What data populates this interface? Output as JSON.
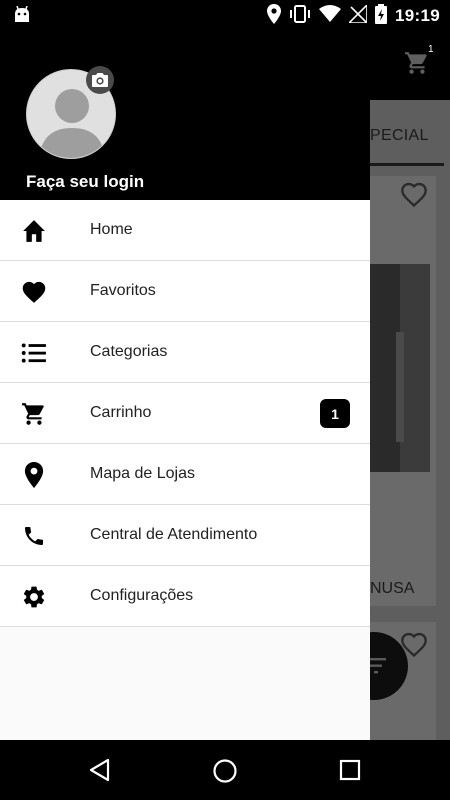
{
  "status_bar": {
    "time": "19:19"
  },
  "background_app": {
    "tab_label": "PECIAL",
    "cart_count": "1",
    "card_text": "NUSA"
  },
  "drawer": {
    "login_text": "Faça seu login",
    "menu": [
      {
        "label": "Home",
        "icon": "home-icon"
      },
      {
        "label": "Favoritos",
        "icon": "heart-icon"
      },
      {
        "label": "Categorias",
        "icon": "list-icon"
      },
      {
        "label": "Carrinho",
        "icon": "cart-icon",
        "badge": "1"
      },
      {
        "label": "Mapa de Lojas",
        "icon": "location-pin-icon"
      },
      {
        "label": "Central de Atendimento",
        "icon": "phone-icon"
      },
      {
        "label": "Configurações",
        "icon": "gear-icon"
      }
    ]
  },
  "colors": {
    "header_bg": "#000000",
    "drawer_bg": "#fafafa",
    "badge_bg": "#000000",
    "scrim": "#5e5e5e"
  }
}
